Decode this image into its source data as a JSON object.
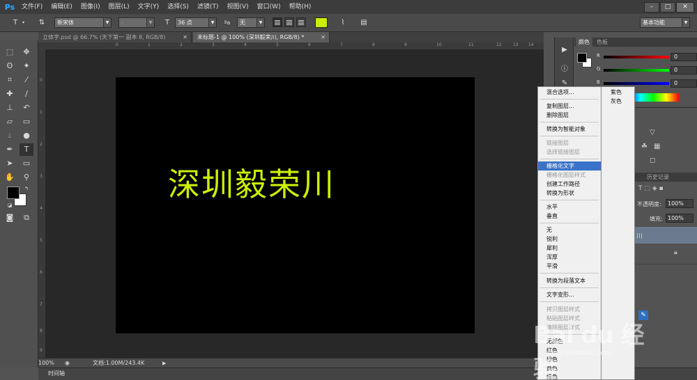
{
  "app": {
    "logo": "Ps",
    "menu": [
      "文件(F)",
      "编辑(E)",
      "图像(I)",
      "图层(L)",
      "文字(Y)",
      "选择(S)",
      "滤镜(T)",
      "视图(V)",
      "窗口(W)",
      "帮助(H)"
    ],
    "window_controls": [
      "–",
      "□",
      "✕"
    ]
  },
  "options": {
    "font_family": "新宋体",
    "font_style": "-",
    "font_size": "36 点",
    "aa_label": "ªa",
    "aa_mode": "无",
    "text_color": "#ccee00",
    "workspace": "基本功能"
  },
  "tabs": [
    {
      "label": "立体字.psd @ 66.7% (天下第一 副本 8, RGB/8)",
      "close": "✕"
    },
    {
      "label": "未标题-1 @ 100% (深圳毅荣川, RGB/8) *",
      "close": "✕"
    }
  ],
  "ruler": {
    "top": [
      "0",
      "1",
      "2",
      "3",
      "4",
      "5",
      "6",
      "7",
      "8",
      "9",
      "10",
      "11",
      "12",
      "13",
      "14"
    ],
    "left": [
      "0",
      "1",
      "2",
      "3",
      "4",
      "5",
      "6",
      "7",
      "8",
      "9"
    ]
  },
  "canvas": {
    "text": "深圳毅荣川",
    "background": "#000000"
  },
  "status": {
    "zoom": "100%",
    "doc_info": "文档:1.00M/243.4K"
  },
  "timeline": {
    "label": "时间轴"
  },
  "color_panel": {
    "tabs": [
      "颜色",
      "色板"
    ],
    "channels": [
      {
        "name": "R",
        "value": "0"
      },
      {
        "name": "G",
        "value": "0"
      },
      {
        "name": "B",
        "value": "0"
      }
    ]
  },
  "layers_panel": {
    "history_tab": "历史记录",
    "opacity_label": "不透明度:",
    "opacity_value": "100%",
    "fill_label": "填充:",
    "fill_value": "100%",
    "layer_name_fragment": "川"
  },
  "context_menu": {
    "items": [
      {
        "label": "混合选项...",
        "state": "normal"
      },
      {
        "label": "复制图层...",
        "state": "normal"
      },
      {
        "label": "删除图层",
        "state": "normal"
      },
      {
        "label": "转换为智能对象",
        "state": "normal"
      },
      {
        "label": "链接图层",
        "state": "disabled"
      },
      {
        "label": "选择链接图层",
        "state": "disabled"
      },
      {
        "label": "栅格化文字",
        "state": "highlighted"
      },
      {
        "label": "栅格化图层样式",
        "state": "disabled"
      },
      {
        "label": "创建工作路径",
        "state": "normal"
      },
      {
        "label": "转换为形状",
        "state": "normal"
      },
      {
        "label": "水平",
        "state": "normal"
      },
      {
        "label": "垂直",
        "state": "normal"
      },
      {
        "label": "无",
        "state": "normal"
      },
      {
        "label": "锐利",
        "state": "normal"
      },
      {
        "label": "犀利",
        "state": "normal"
      },
      {
        "label": "浑厚",
        "state": "normal"
      },
      {
        "label": "平滑",
        "state": "normal"
      },
      {
        "label": "转换为段落文本",
        "state": "normal"
      },
      {
        "label": "文字变形...",
        "state": "normal"
      },
      {
        "label": "拷贝图层样式",
        "state": "disabled"
      },
      {
        "label": "粘贴图层样式",
        "state": "disabled"
      },
      {
        "label": "清除图层样式",
        "state": "disabled"
      },
      {
        "label": "无颜色",
        "state": "normal"
      },
      {
        "label": "红色",
        "state": "normal"
      },
      {
        "label": "橙色",
        "state": "normal"
      },
      {
        "label": "黄色",
        "state": "normal"
      },
      {
        "label": "绿色",
        "state": "normal"
      }
    ],
    "submenu": [
      "紫色",
      "灰色"
    ]
  },
  "watermark": {
    "text": "Bai du 经验",
    "url": "jingyan.baidu.com"
  }
}
